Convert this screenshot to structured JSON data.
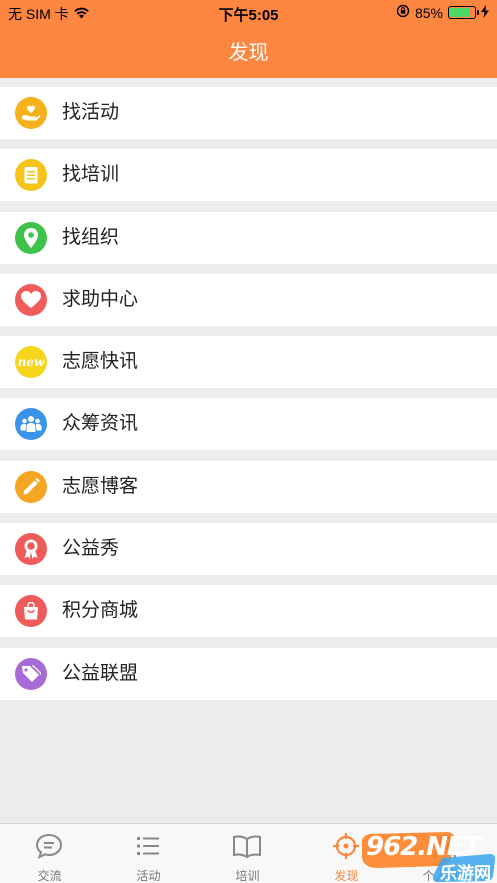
{
  "status_bar": {
    "carrier": "无 SIM 卡",
    "time": "下午5:05",
    "battery_percent": "85%",
    "battery_level": 0.85
  },
  "nav": {
    "title": "发现"
  },
  "menu": [
    {
      "label": "找活动",
      "icon": "hand-heart-icon",
      "color": "#f5b21b"
    },
    {
      "label": "找培训",
      "icon": "notepad-icon",
      "color": "#f5c319"
    },
    {
      "label": "找组织",
      "icon": "map-pin-icon",
      "color": "#3fc24b"
    },
    {
      "label": "求助中心",
      "icon": "heart-icon",
      "color": "#f05b5b"
    },
    {
      "label": "志愿快讯",
      "icon": "new-badge-icon",
      "color": "#f7d51c",
      "badge_text": "new"
    },
    {
      "label": "众筹资讯",
      "icon": "people-group-icon",
      "color": "#3a94e8"
    },
    {
      "label": "志愿博客",
      "icon": "pencil-icon",
      "color": "#f5a623"
    },
    {
      "label": "公益秀",
      "icon": "award-ribbon-icon",
      "color": "#ef5b5b"
    },
    {
      "label": "积分商城",
      "icon": "shopping-bag-icon",
      "color": "#ef5b5b"
    },
    {
      "label": "公益联盟",
      "icon": "tags-icon",
      "color": "#a66bd6"
    }
  ],
  "tabbar": {
    "tabs": [
      {
        "label": "交流",
        "icon": "chat-bubble-icon"
      },
      {
        "label": "活动",
        "icon": "list-icon"
      },
      {
        "label": "培训",
        "icon": "open-book-icon"
      },
      {
        "label": "发现",
        "icon": "crosshair-icon",
        "active": true
      },
      {
        "label": "个人中心",
        "icon": "person-icon"
      }
    ],
    "active_color": "#fd8641"
  },
  "watermark": {
    "text_top": "962.NET",
    "text_bottom": "乐游网"
  },
  "colors": {
    "header": "#fd8641",
    "background": "#ececec"
  }
}
